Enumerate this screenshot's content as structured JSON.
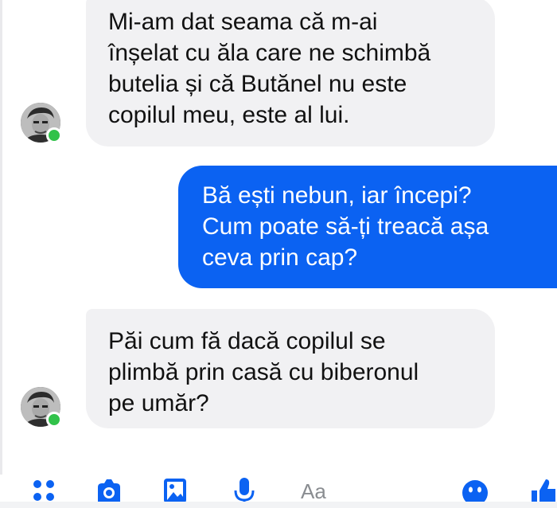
{
  "conversation": {
    "messages": [
      {
        "direction": "incoming",
        "text": "Mi-am dat seama că m-ai\nînșelat cu ăla care ne schimbă\nbutelia și că Butănel nu este\ncopilul meu, este al lui."
      },
      {
        "direction": "outgoing",
        "text": "Bă ești nebun, iar începi?\nCum poate să-ți treacă așa\nceva prin cap?"
      },
      {
        "direction": "incoming",
        "text": "Păi cum fă dacă copilul se\nplimbă prin casă cu biberonul\npe umăr?"
      }
    ],
    "contact": {
      "status": "online"
    }
  },
  "composer": {
    "placeholder": "Aa",
    "icons": [
      "apps-icon",
      "camera-icon",
      "image-icon",
      "microphone-icon",
      "emoji-icon",
      "like-icon"
    ]
  },
  "colors": {
    "incoming_bubble": "#f1f1f3",
    "outgoing_bubble": "#0b62f2",
    "accent": "#0b62f2",
    "online": "#31c24a"
  }
}
